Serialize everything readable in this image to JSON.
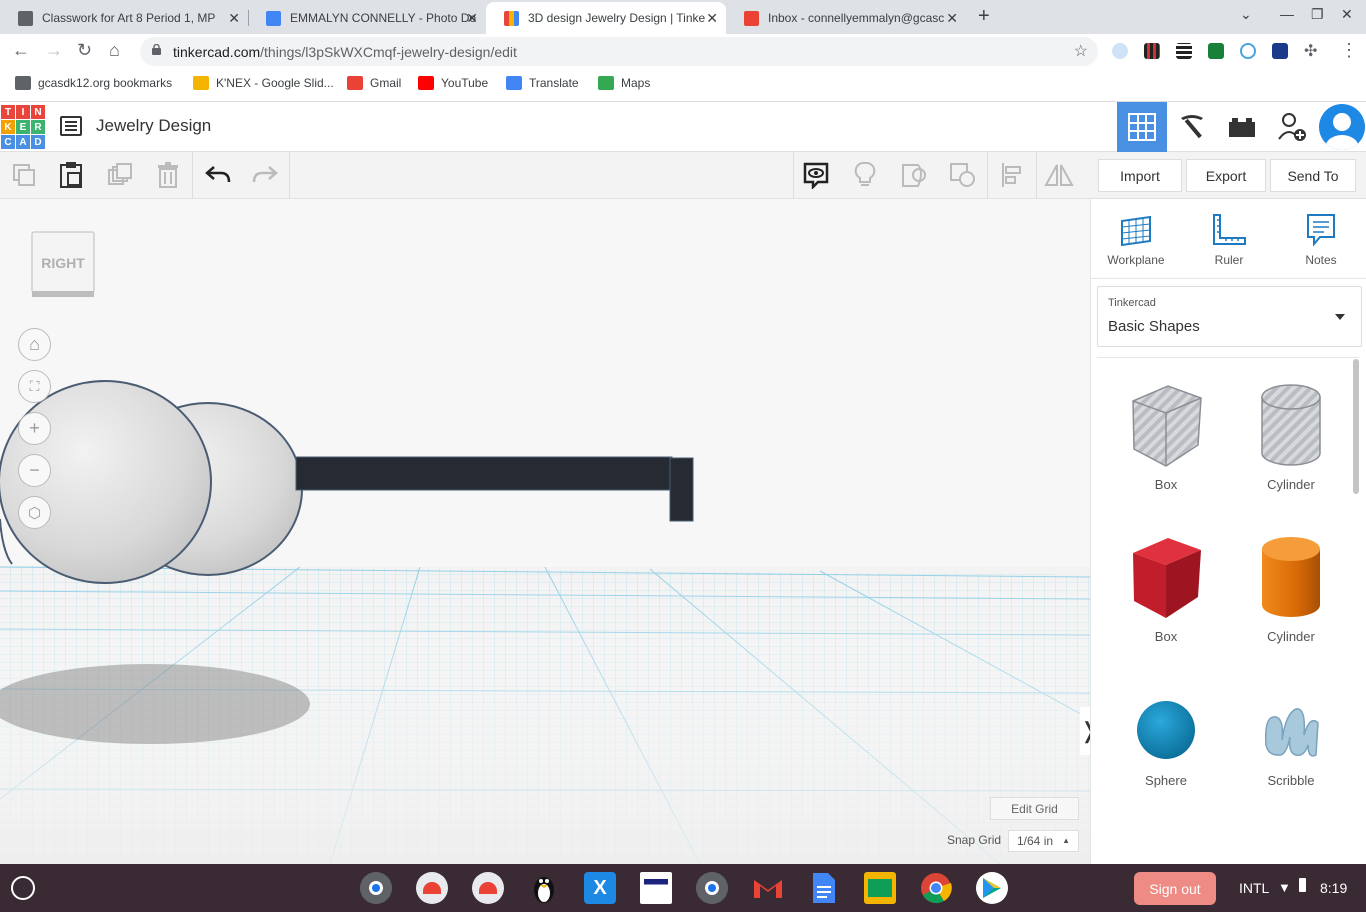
{
  "browser": {
    "tabs": [
      {
        "title": "Classwork for Art 8 Period 1, MP",
        "favicon_color": "#5f6368"
      },
      {
        "title": "EMMALYN CONNELLY - Photo Do",
        "favicon_color": "#4285f4"
      },
      {
        "title": "3D design Jewelry Design | Tinke",
        "favicon_color": "#e8453c"
      },
      {
        "title": "Inbox - connellyemmalyn@gcasc",
        "favicon_color": "#ea4335"
      }
    ],
    "url_host": "tinkercad.com",
    "url_path": "/things/l3pSkWXCmqf-jewelry-design/edit",
    "bookmarks": [
      {
        "label": "gcasdk12.org bookmarks",
        "color": "#5f6368"
      },
      {
        "label": "K'NEX - Google Slid...",
        "color": "#f4b400"
      },
      {
        "label": "Gmail",
        "color": "#ea4335"
      },
      {
        "label": "YouTube",
        "color": "#ff0000"
      },
      {
        "label": "Translate",
        "color": "#4285f4"
      },
      {
        "label": "Maps",
        "color": "#34a853"
      }
    ]
  },
  "app": {
    "logo_letters": [
      "T",
      "I",
      "N",
      "K",
      "E",
      "R",
      "C",
      "A",
      "D"
    ],
    "project_title": "Jewelry Design",
    "toolbar": {
      "import_label": "Import",
      "export_label": "Export",
      "send_to_label": "Send To"
    },
    "viewcube_label": "RIGHT",
    "edit_grid_label": "Edit Grid",
    "snap_grid_label": "Snap Grid",
    "snap_grid_value": "1/64 in",
    "accent_color": "#4a90e2"
  },
  "panel": {
    "top_items": [
      {
        "label": "Workplane",
        "icon": "workplane-icon"
      },
      {
        "label": "Ruler",
        "icon": "ruler-icon"
      },
      {
        "label": "Notes",
        "icon": "notes-icon"
      }
    ],
    "library_small": "Tinkercad",
    "library_name": "Basic Shapes",
    "shapes": [
      {
        "label": "Box"
      },
      {
        "label": "Cylinder"
      },
      {
        "label": "Box"
      },
      {
        "label": "Cylinder"
      },
      {
        "label": "Sphere"
      },
      {
        "label": "Scribble"
      }
    ]
  },
  "shelf": {
    "sign_out_label": "Sign out",
    "input_method": "INTL",
    "time": "8:19"
  }
}
